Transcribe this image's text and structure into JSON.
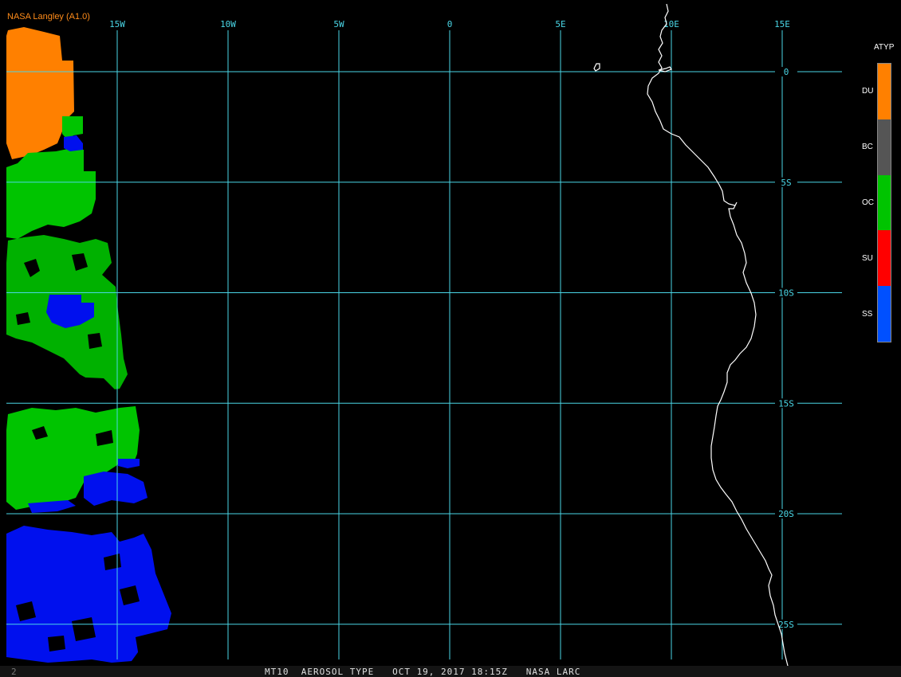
{
  "credit": "NASA Langley (A1.0)",
  "legend": {
    "title": "ATYP",
    "items": [
      {
        "label": "DU",
        "color": "#ff8000"
      },
      {
        "label": "BC",
        "color": "#555555"
      },
      {
        "label": "OC",
        "color": "#00c400"
      },
      {
        "label": "SU",
        "color": "#ff0000"
      },
      {
        "label": "SS",
        "color": "#0050ff"
      }
    ]
  },
  "grid": {
    "color": "#4ad6e6",
    "longitudes": [
      {
        "label": "15W",
        "value": -15
      },
      {
        "label": "10W",
        "value": -10
      },
      {
        "label": "5W",
        "value": -5
      },
      {
        "label": "0",
        "value": 0
      },
      {
        "label": "5E",
        "value": 5
      },
      {
        "label": "10E",
        "value": 10
      },
      {
        "label": "15E",
        "value": 15
      }
    ],
    "latitudes": [
      {
        "label": "0",
        "value": 0
      },
      {
        "label": "5S",
        "value": -5
      },
      {
        "label": "10S",
        "value": -10
      },
      {
        "label": "15S",
        "value": -15
      },
      {
        "label": "20S",
        "value": -20
      },
      {
        "label": "25S",
        "value": -25
      }
    ]
  },
  "status": {
    "frame_number": "2",
    "text": "MT10  AEROSOL TYPE   OCT 19, 2017 18:15Z   NASA LARC"
  }
}
